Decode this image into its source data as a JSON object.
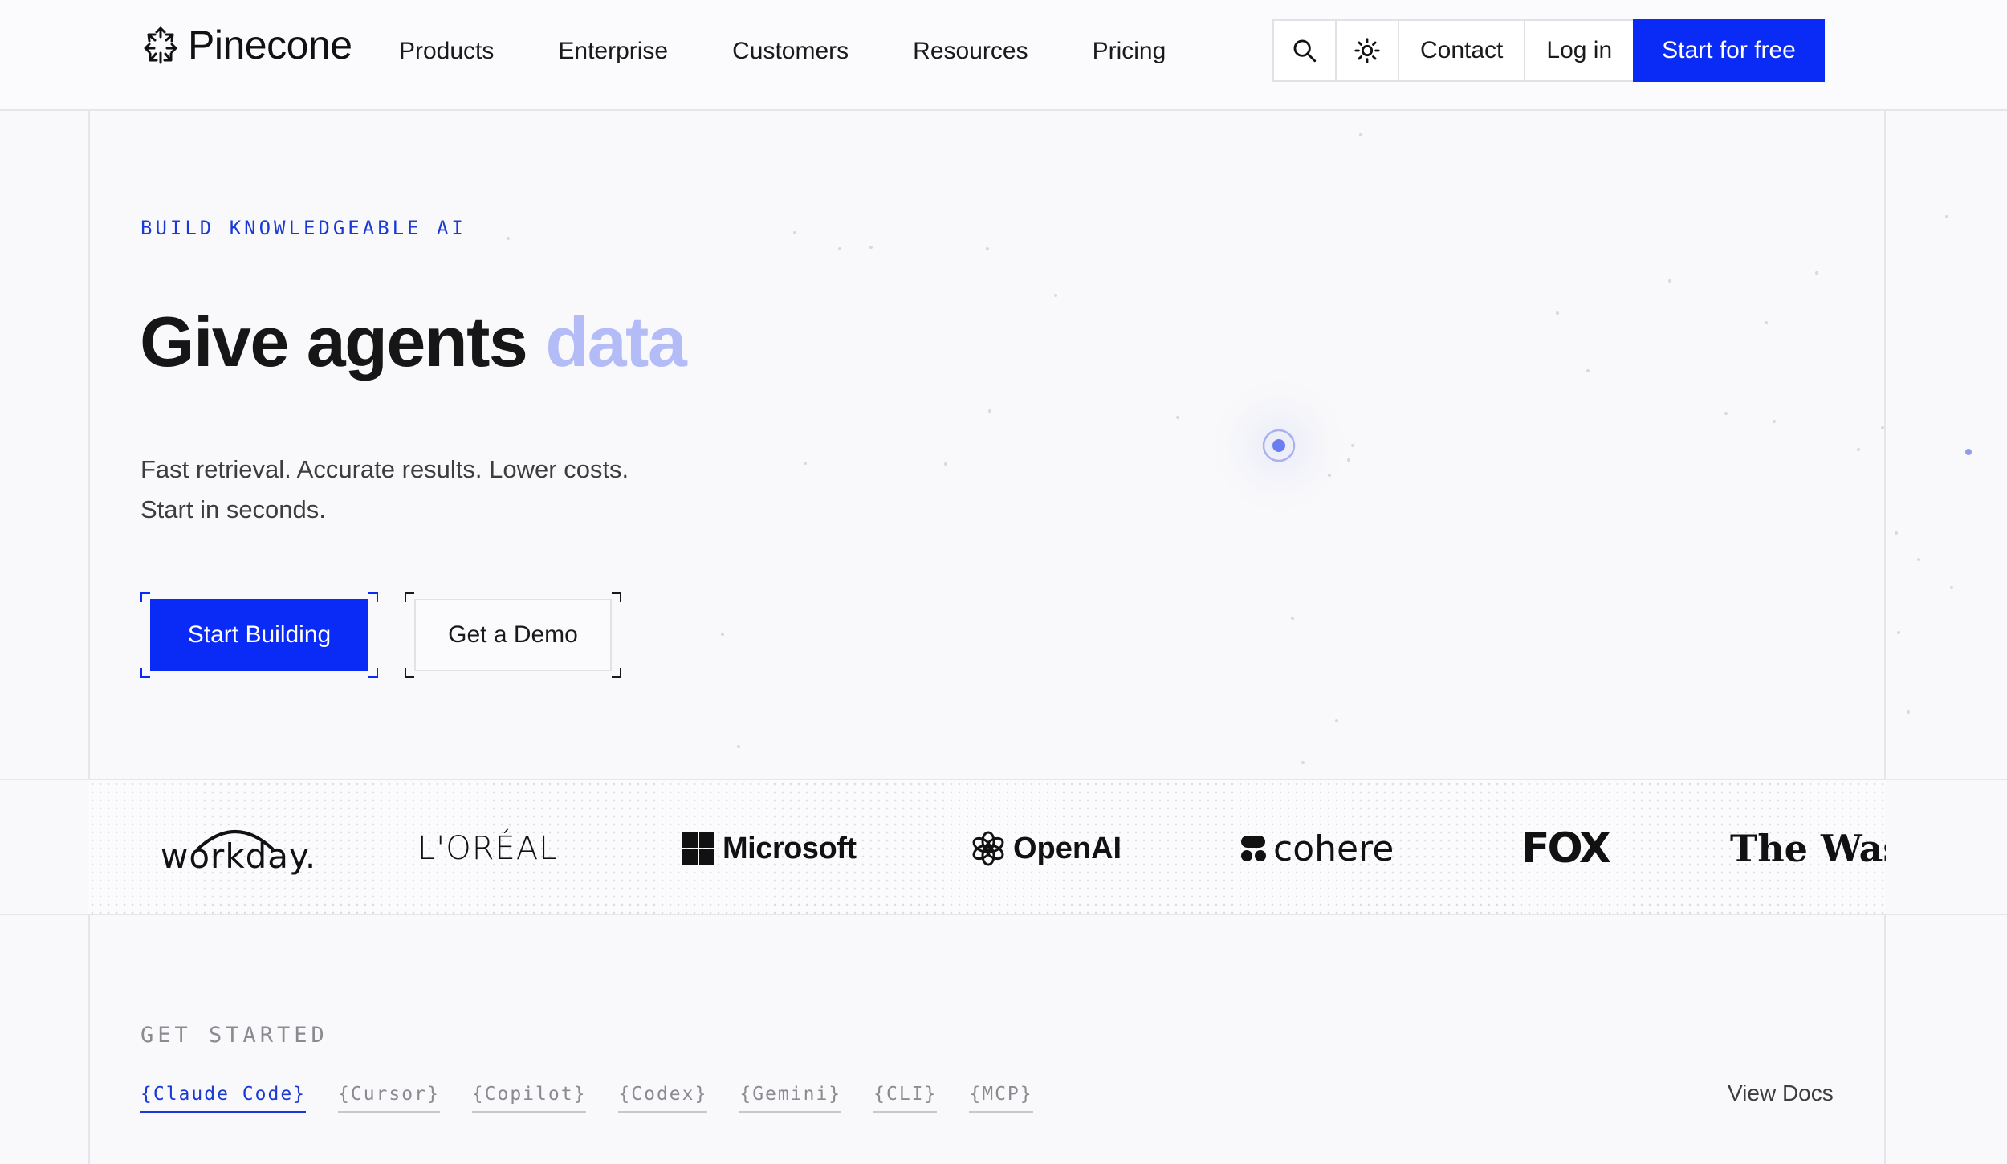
{
  "brand": {
    "name": "Pinecone",
    "accent": "#0a2af5"
  },
  "nav": {
    "items": [
      {
        "label": "Products"
      },
      {
        "label": "Enterprise"
      },
      {
        "label": "Customers"
      },
      {
        "label": "Resources"
      },
      {
        "label": "Pricing"
      }
    ]
  },
  "header_actions": {
    "search_icon": "search-icon",
    "theme_icon": "sun-icon",
    "contact": "Contact",
    "login": "Log in",
    "start_free": "Start for free"
  },
  "hero": {
    "eyebrow": "BUILD KNOWLEDGEABLE AI",
    "title_main": "Give agents",
    "title_accent": "data",
    "subtitle_line1": "Fast retrieval. Accurate results. Lower costs.",
    "subtitle_line2": "Start in seconds.",
    "cta_primary": "Start Building",
    "cta_secondary": "Get a Demo"
  },
  "customer_logos": [
    {
      "name": "workday."
    },
    {
      "name": "L'ORÉAL"
    },
    {
      "name": "Microsoft"
    },
    {
      "name": "OpenAI"
    },
    {
      "name": "cohere"
    },
    {
      "name": "FOX"
    },
    {
      "name": "The Washi"
    }
  ],
  "get_started": {
    "label": "GET STARTED",
    "tabs": [
      {
        "label": "{Claude Code}",
        "active": true
      },
      {
        "label": "{Cursor}",
        "active": false
      },
      {
        "label": "{Copilot}",
        "active": false
      },
      {
        "label": "{Codex}",
        "active": false
      },
      {
        "label": "{Gemini}",
        "active": false
      },
      {
        "label": "{CLI}",
        "active": false
      },
      {
        "label": "{MCP}",
        "active": false
      }
    ],
    "view_docs": "View Docs"
  }
}
